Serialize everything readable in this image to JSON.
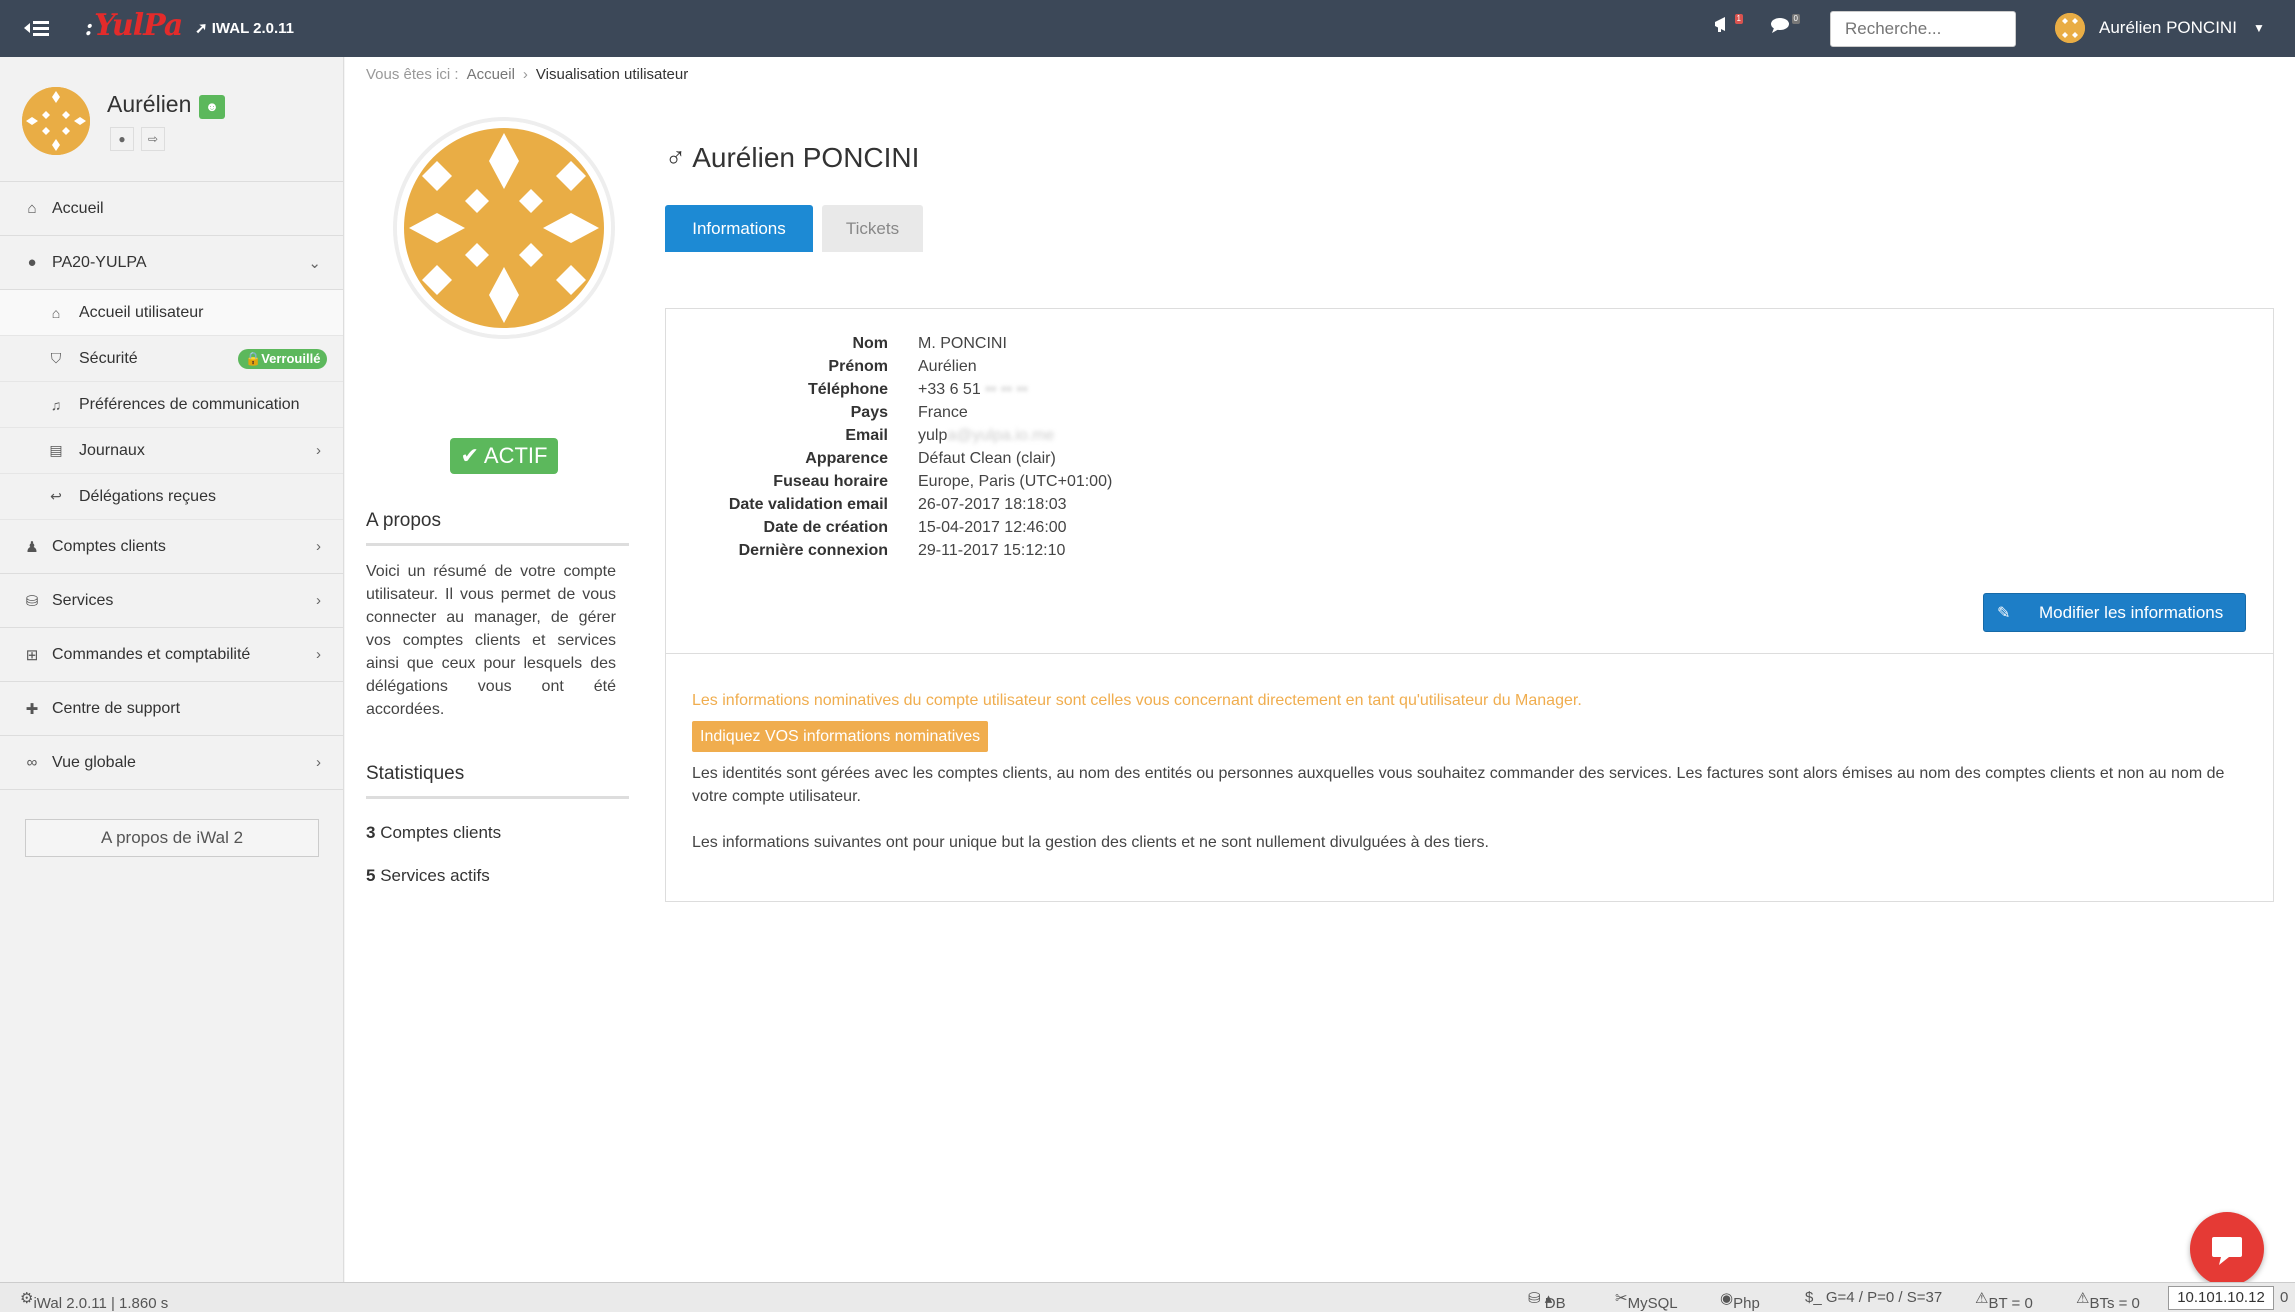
{
  "topbar": {
    "logo": "YulPa",
    "version": "IWAL 2.0.11",
    "notif_badge": "1",
    "chat_badge": "0",
    "search_placeholder": "Recherche...",
    "user_name": "Aurélien PONCINI"
  },
  "sidebar": {
    "profile_name": "Aurélien",
    "items": [
      {
        "label": "Accueil"
      },
      {
        "label": "PA20-YULPA"
      },
      {
        "label": "Accueil utilisateur"
      },
      {
        "label": "Sécurité",
        "badge": "Verrouillé"
      },
      {
        "label": "Préférences de communication"
      },
      {
        "label": "Journaux"
      },
      {
        "label": "Délégations reçues"
      },
      {
        "label": "Comptes clients"
      },
      {
        "label": "Services"
      },
      {
        "label": "Commandes et comptabilité"
      },
      {
        "label": "Centre de support"
      },
      {
        "label": "Vue globale"
      }
    ],
    "about_button": "A propos de iWal 2"
  },
  "breadcrumb": {
    "prefix": "Vous êtes ici :",
    "home": "Accueil",
    "current": "Visualisation utilisateur"
  },
  "profile": {
    "status": "ACTIF",
    "about_title": "A propos",
    "about_text": "Voici un résumé de votre compte utilisateur. Il vous permet de vous connecter au manager, de gérer vos comptes clients et services ainsi que ceux pour lesquels des délégations vous ont été accordées.",
    "stats_title": "Statistiques",
    "stat1_count": "3",
    "stat1_label": " Comptes clients",
    "stat2_count": "5",
    "stat2_label": " Services actifs"
  },
  "user": {
    "title": "Aurélien PONCINI",
    "gender_symbol": "♂"
  },
  "tabs": {
    "info": "Informations",
    "tickets": "Tickets"
  },
  "info": {
    "rows": [
      {
        "label": "Nom",
        "value": "M. PONCINI"
      },
      {
        "label": "Prénom",
        "value": "Aurélien"
      },
      {
        "label": "Téléphone",
        "value": "+33 6 51",
        "blurred": "•• •• ••"
      },
      {
        "label": "Pays",
        "value": "France"
      },
      {
        "label": "Email",
        "value": "yulp",
        "blurred": "a@yulpa.io.me"
      },
      {
        "label": "Apparence",
        "value": "Défaut Clean (clair)"
      },
      {
        "label": "Fuseau horaire",
        "value": "Europe, Paris (UTC+01:00)"
      },
      {
        "label": "Date validation email",
        "value": "26-07-2017 18:18:03"
      },
      {
        "label": "Date de création",
        "value": "15-04-2017 12:46:00"
      },
      {
        "label": "Dernière connexion",
        "value": "29-11-2017 15:12:10"
      }
    ],
    "edit_button": "Modifier les informations",
    "warning_text": "Les informations nominatives du compte utilisateur sont celles vous concernant directement en tant qu'utilisateur du Manager.",
    "warning_label": "Indiquez VOS informations nominatives",
    "desc1": "Les identités sont gérées avec les comptes clients, au nom des entités ou personnes auxquelles vous souhaitez commander des services. Les factures sont alors émises au nom des comptes clients et non au nom de votre compte utilisateur.",
    "desc2": "Les informations suivantes ont pour unique but la gestion des clients et ne sont nullement divulguées à des tiers."
  },
  "footer": {
    "version": "iWal 2.0.11 | 1.860 s",
    "db": "DB",
    "mysql": "MySQL",
    "php": "Php",
    "counters": "$_ G=4 / P=0 / S=37",
    "bt": "BT = 0",
    "bts": "BTs = 0",
    "ip": "10.101.10.12",
    "tail": "0"
  },
  "colors": {
    "topbar": "#3c4858",
    "primary": "#1d8ad4",
    "success": "#5cb85c",
    "warning": "#f0ad4e",
    "chat": "#e53a35"
  }
}
